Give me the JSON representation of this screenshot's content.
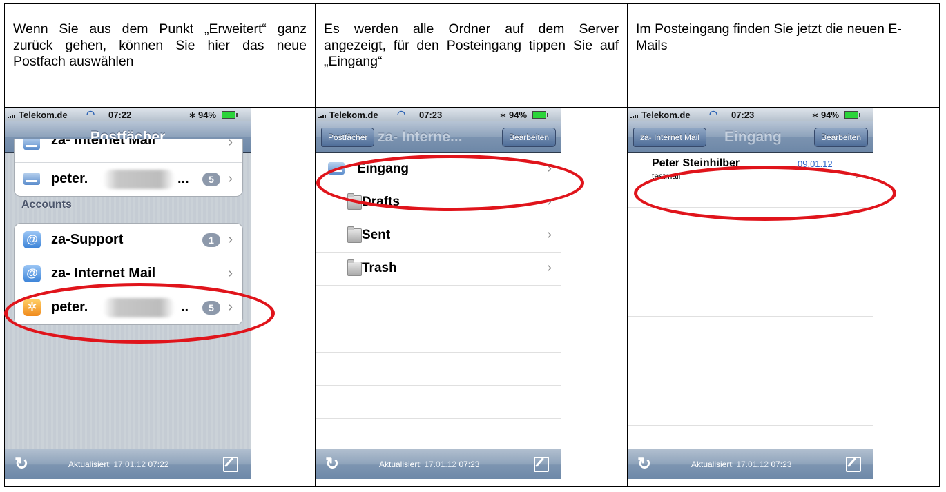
{
  "instructions": {
    "col1": "Wenn Sie aus dem Punkt „Erweitert“ ganz zurück gehen, können Sie hier das neue Postfach auswählen",
    "col2": "Es werden alle Ordner auf dem Server angezeigt, für den Posteingang tippen Sie auf „Eingang“",
    "col3": "Im Posteingang finden Sie jetzt die neuen E-Mails"
  },
  "screens": [
    {
      "status": {
        "carrier": "Telekom.de",
        "time": "07:22",
        "battery": "94%"
      },
      "nav": {
        "title": "Postfächer"
      },
      "mailboxes": [
        {
          "label": "za- Internet Mail"
        },
        {
          "label": "peter.",
          "suffix": "...",
          "badge": "5"
        }
      ],
      "accounts_header": "Accounts",
      "accounts": [
        {
          "label": "za-Support",
          "badge": "1"
        },
        {
          "label": "za- Internet Mail"
        },
        {
          "label": "peter.",
          "suffix": "..",
          "badge": "5"
        }
      ],
      "toolbar": {
        "updated_label": "Aktualisiert:",
        "date": "17.01.12",
        "time": "07:22"
      }
    },
    {
      "status": {
        "carrier": "Telekom.de",
        "time": "07:23",
        "battery": "94%"
      },
      "nav": {
        "back": "Postfächer",
        "title": "za- Interne...",
        "edit": "Bearbeiten"
      },
      "folders": [
        {
          "label": "Eingang"
        },
        {
          "label": "Drafts"
        },
        {
          "label": "Sent"
        },
        {
          "label": "Trash"
        }
      ],
      "toolbar": {
        "updated_label": "Aktualisiert:",
        "date": "17.01.12",
        "time": "07:23"
      }
    },
    {
      "status": {
        "carrier": "Telekom.de",
        "time": "07:23",
        "battery": "94%"
      },
      "nav": {
        "back": "za- Internet Mail",
        "title": "Eingang",
        "edit": "Bearbeiten"
      },
      "message": {
        "from": "Peter Steinhilber",
        "date": "09.01.12",
        "subject": "testmail"
      },
      "toolbar": {
        "updated_label": "Aktualisiert:",
        "date": "17.01.12",
        "time": "07:23"
      }
    }
  ],
  "colors": {
    "highlight_ring": "#e0141b",
    "nav_blue": "#6d87a7",
    "link_blue": "#2a63c8"
  }
}
